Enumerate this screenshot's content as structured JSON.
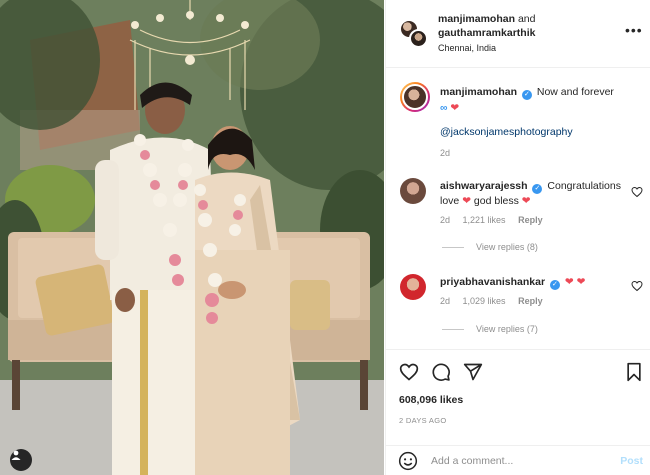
{
  "post": {
    "author_1": "manjimamohan",
    "joiner": "and",
    "author_2": "gauthamramkarthik",
    "location": "Chennai, India",
    "more_icon": "more-horizontal-icon"
  },
  "caption": {
    "username": "manjimamohan",
    "text": "Now and forever",
    "emoji_1": "∞",
    "emoji_2": "❤",
    "mention": "@jacksonjamesphotography",
    "time": "2d"
  },
  "comments": [
    {
      "username": "aishwaryarajessh",
      "text_1": "Congratulations love",
      "emoji_1": "❤",
      "text_2": "god bless",
      "emoji_2": "❤",
      "time": "2d",
      "likes": "1,221 likes",
      "reply": "Reply",
      "view_replies": "View replies (8)"
    },
    {
      "username": "priyabhavanishankar",
      "text_1": "",
      "emoji_1": "❤",
      "emoji_2": "❤",
      "time": "2d",
      "likes": "1,029 likes",
      "reply": "Reply",
      "view_replies": "View replies (7)"
    }
  ],
  "actions": {
    "like_icon": "heart-icon",
    "comment_icon": "comment-icon",
    "share_icon": "share-icon",
    "save_icon": "bookmark-icon",
    "likes_count": "608,096 likes",
    "date": "2 DAYS AGO"
  },
  "comment_box": {
    "placeholder": "Add a comment...",
    "post_label": "Post"
  },
  "colors": {
    "accent_blue": "#3897f0",
    "heart_red": "#ed4956",
    "link_blue": "#00376b",
    "muted": "#8e8e8e"
  }
}
